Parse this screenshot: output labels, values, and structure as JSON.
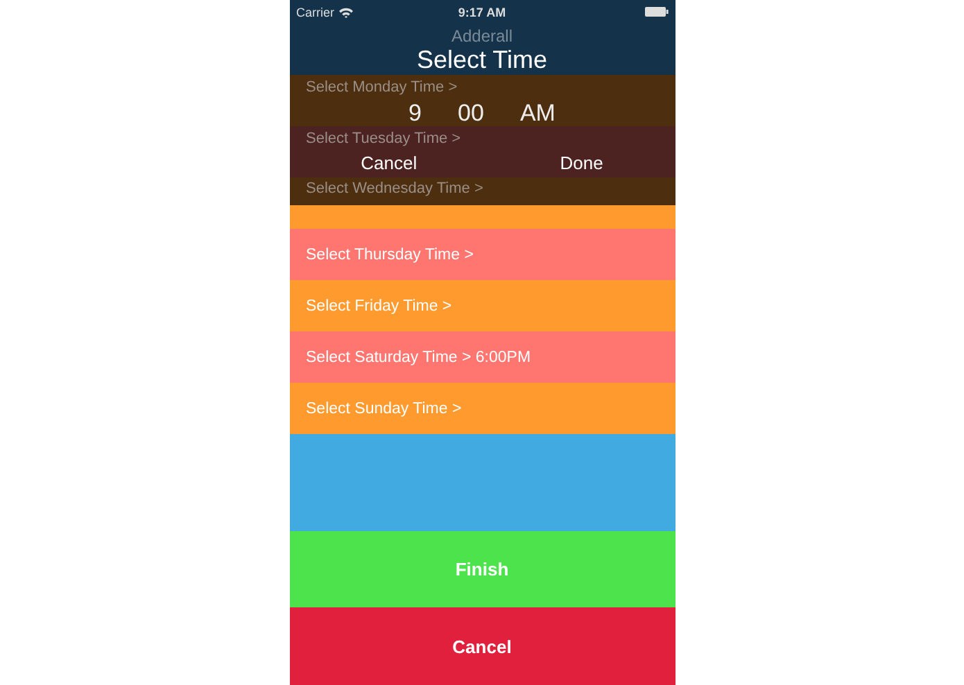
{
  "status_bar": {
    "carrier": "Carrier",
    "time": "9:17 AM"
  },
  "nav_bar": {
    "title": "Adderall"
  },
  "rows": [
    {
      "label": "Select Monday Time >",
      "color": "#4d2e0e",
      "kind": "dimmed"
    },
    {
      "label": "Select Tuesday Time >",
      "color": "#4d2321",
      "kind": "dimmed"
    },
    {
      "label": "Select Wednesday Time >",
      "color": "#ff9a2e",
      "kind": "partly-dimmed"
    },
    {
      "label": "Select Thursday Time >",
      "color": "#ff7670",
      "kind": "normal"
    },
    {
      "label": "Select Friday Time >",
      "color": "#ff9a2e",
      "kind": "normal"
    },
    {
      "label": "Select Saturday Time > 6:00PM",
      "color": "#ff7670",
      "kind": "normal"
    },
    {
      "label": "Select Sunday Time >",
      "color": "#ff9a2e",
      "kind": "normal"
    }
  ],
  "buttons": [
    {
      "label": "Finish",
      "kind": "finish"
    },
    {
      "label": "Cancel",
      "kind": "cancel"
    }
  ],
  "time_picker": {
    "title": "Select Time",
    "columns": [
      "9",
      "00",
      "AM"
    ],
    "cancel": "Cancel",
    "done": "Done"
  }
}
